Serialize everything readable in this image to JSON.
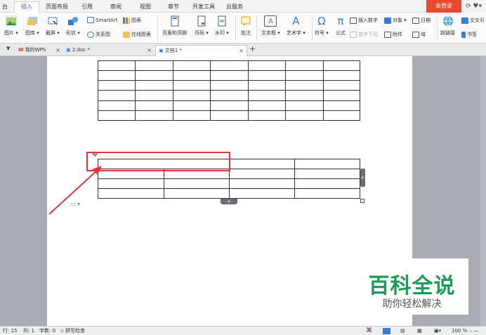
{
  "menubar": {
    "items": [
      {
        "label": "台"
      },
      {
        "label": "插入"
      },
      {
        "label": "页面布局"
      },
      {
        "label": "引用"
      },
      {
        "label": "审阅"
      },
      {
        "label": "视图"
      },
      {
        "label": "章节"
      },
      {
        "label": "开发工具"
      },
      {
        "label": "云服务"
      }
    ],
    "active": "插入",
    "login": "未登录",
    "right_icons": "⟳ ♥▾"
  },
  "ribbon": {
    "big_buttons": [
      {
        "label": "图片 ▾",
        "icon": "picture-icon"
      },
      {
        "label": "图库 ▾",
        "icon": "gallery-icon"
      },
      {
        "label": "截屏 ▾",
        "icon": "screenshot-icon"
      },
      {
        "label": "形状 ▾",
        "icon": "shape-icon"
      },
      {
        "label": "页眉和页脚",
        "icon": "header-footer-icon"
      },
      {
        "label": "页码 ▾",
        "icon": "page-number-icon"
      },
      {
        "label": "水印 ▾",
        "icon": "watermark-icon"
      },
      {
        "label": "批注",
        "icon": "comment-icon"
      },
      {
        "label": "文本框 ▾",
        "icon": "textbox-icon"
      },
      {
        "label": "艺术字 ▾",
        "icon": "wordart-icon"
      },
      {
        "label": "符号 ▾",
        "icon": "symbol-icon"
      },
      {
        "label": "公式",
        "icon": "formula-icon"
      },
      {
        "label": "超链接",
        "icon": "hyperlink-icon"
      }
    ],
    "small_buttons": {
      "smartart": "SmartArt",
      "chart": "图表",
      "relation": "关系图",
      "online_chart": "在线图表",
      "insert_number": "插入数字",
      "object": "对象 ▾",
      "date": "日期",
      "first_drop": "首字下沉",
      "attachment": "附件",
      "field": "域",
      "cross_ref": "交叉引",
      "bookmark": "书签"
    },
    "icon_glyphs": {
      "textbox": "A",
      "wordart": "A",
      "symbol": "Ω",
      "formula": "π"
    }
  },
  "tabs": [
    {
      "label": "我的WPS",
      "logo": "W"
    },
    {
      "label": "2.doc *"
    },
    {
      "label": "文档1 *"
    }
  ],
  "tab_close": "×",
  "tab_add": "+",
  "tab_menu": "▼",
  "table_handles": {
    "move": "✥",
    "add_row": "+",
    "add_col": "+",
    "paste_options": "▭ ▾"
  },
  "status": {
    "row": "行: 15",
    "col": "列: 1",
    "words": "字数: 0",
    "spell": "拼写检查",
    "zoom": "100 %",
    "zoom_controls": "–  —"
  },
  "watermark": {
    "main": "百科全说",
    "sub": "助你轻松解决"
  },
  "colors": {
    "accent": "#2e6bd4",
    "highlight_box": "#e8333a",
    "login": "#e84a2f",
    "watermark_green": "#1d9a57"
  }
}
